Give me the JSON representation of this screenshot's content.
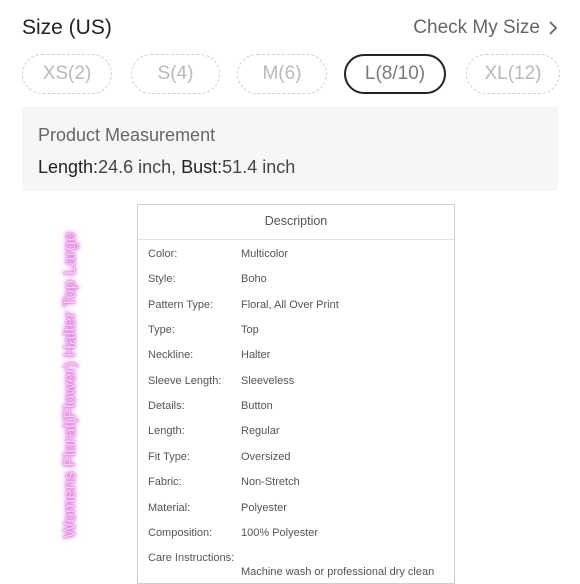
{
  "size": {
    "title": "Size (US)",
    "check_link": "Check My Size",
    "options": [
      {
        "label": "XS(2)",
        "selected": false
      },
      {
        "label": "S(4)",
        "selected": false
      },
      {
        "label": "M(6)",
        "selected": false
      },
      {
        "label": "L(8/10)",
        "selected": true
      },
      {
        "label": "XL(12)",
        "selected": false
      }
    ]
  },
  "measurement": {
    "title": "Product Measurement",
    "length_label": "Length:",
    "length_value": "24.6 inch",
    "separator": ", ",
    "bust_label": "Bust:",
    "bust_value": "51.4 inch"
  },
  "side_label": "Womens Floral(Flower) Halter Top Large",
  "description": {
    "title": "Description",
    "rows": [
      {
        "key": "Color:",
        "value": "Multicolor"
      },
      {
        "key": "Style:",
        "value": "Boho"
      },
      {
        "key": "Pattern Type:",
        "value": "Floral, All Over Print"
      },
      {
        "key": "Type:",
        "value": "Top"
      },
      {
        "key": "Neckline:",
        "value": "Halter"
      },
      {
        "key": "Sleeve Length:",
        "value": "Sleeveless"
      },
      {
        "key": "Details:",
        "value": "Button"
      },
      {
        "key": "Length:",
        "value": "Regular"
      },
      {
        "key": "Fit Type:",
        "value": "Oversized"
      },
      {
        "key": "Fabric:",
        "value": "Non-Stretch"
      },
      {
        "key": "Material:",
        "value": "Polyester"
      },
      {
        "key": "Composition:",
        "value": "100% Polyester"
      },
      {
        "key": "Care Instructions:",
        "value": "Machine wash or professional dry clean"
      }
    ]
  }
}
